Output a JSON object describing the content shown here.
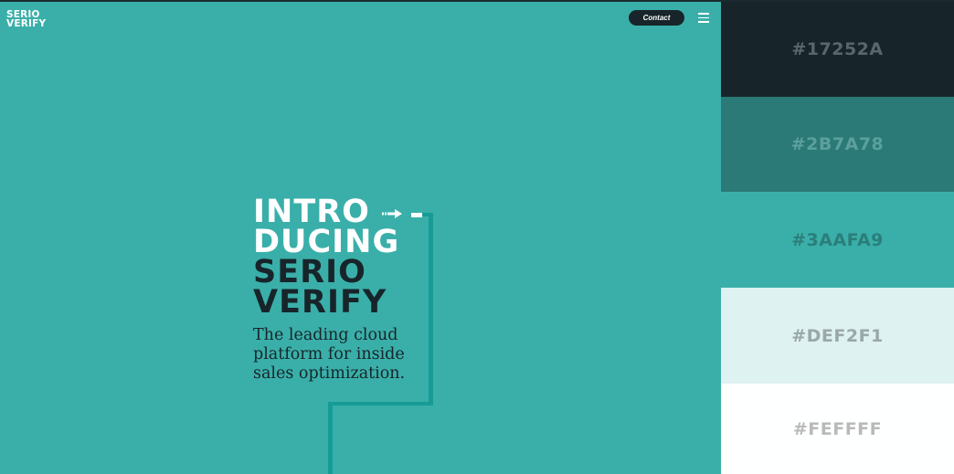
{
  "header": {
    "logo_line1": "SERIO",
    "logo_line2": "VERIFY",
    "contact_label": "Contact",
    "menu_icon": "hamburger-menu-icon"
  },
  "hero": {
    "headline_line1": "INTRO",
    "headline_line2": "DUCING",
    "headline_line3": "SERIO",
    "headline_line4": "VERIFY",
    "tagline_line1": "The leading cloud",
    "tagline_line2": "platform for inside",
    "tagline_line3": "sales optimization.",
    "arrow_icon": "arrow-right-icon"
  },
  "palette": {
    "swatches": [
      {
        "label": "#17252A",
        "color": "#17252A",
        "text_color": "#5a666a"
      },
      {
        "label": "#2B7A78",
        "color": "#2B7A78",
        "text_color": "#5ba09d"
      },
      {
        "label": "#3AAFA9",
        "color": "#3AAFA9",
        "text_color": "#2b7e7a"
      },
      {
        "label": "#DEF2F1",
        "color": "#DEF2F1",
        "text_color": "#9aa8a8"
      },
      {
        "label": "#FEFFFF",
        "color": "#FEFFFF",
        "text_color": "#b9b9b9"
      }
    ]
  },
  "colors": {
    "background": "#3AAFA9",
    "dark": "#17252A",
    "rail": "#179b96",
    "white": "#ffffff"
  }
}
